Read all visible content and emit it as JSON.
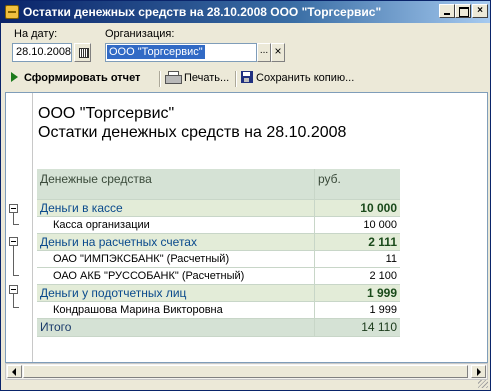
{
  "window": {
    "title": "Остатки денежных средств на 28.10.2008 ООО \"Торгсервис\""
  },
  "params": {
    "date_label": "На дату:",
    "date_value": "28.10.2008",
    "org_label": "Организация:",
    "org_value": "ООО \"Торгсервис\"",
    "org_select_glyph": "...",
    "org_clear_glyph": "×"
  },
  "toolbar": {
    "form_label": "Сформировать отчет",
    "print_label": "Печать...",
    "save_label": "Сохранить копию..."
  },
  "report": {
    "title_line1": "ООО \"Торгсервис\"",
    "title_line2": "Остатки денежных средств на 28.10.2008",
    "columns": [
      "Денежные средства",
      "руб."
    ],
    "rows": [
      {
        "kind": "group",
        "name": "Деньги в кассе",
        "value": "10 000"
      },
      {
        "kind": "detail",
        "name": "Касса организации",
        "value": "10 000"
      },
      {
        "kind": "group",
        "name": "Деньги на расчетных счетах",
        "value": "2 111"
      },
      {
        "kind": "detail",
        "name": "ОАО \"ИМПЭКСБАНК\" (Расчетный)",
        "value": "11"
      },
      {
        "kind": "detail",
        "name": "ОАО АКБ \"РУССОБАНК\" (Расчетный)",
        "value": "2 100"
      },
      {
        "kind": "group",
        "name": "Деньги у подотчетных лиц",
        "value": "1 999"
      },
      {
        "kind": "detail",
        "name": "Кондрашова Марина Викторовна",
        "value": "1 999"
      },
      {
        "kind": "total",
        "name": "Итого",
        "value": "14 110"
      }
    ]
  },
  "icons": {
    "title": "report-icon",
    "form": "play-icon",
    "print": "printer-icon",
    "save": "floppy-disk-icon",
    "calendar": "calendar-icon",
    "tree_toggle": "collapse-icon"
  },
  "colors": {
    "title_bar": "#0a246a",
    "selection": "#316ac5",
    "table_header_bg": "#d5e2d5",
    "group_row_bg": "#e3ecd8",
    "group_text": "#0a4a8c",
    "play_icon": "#1b7a1b"
  }
}
